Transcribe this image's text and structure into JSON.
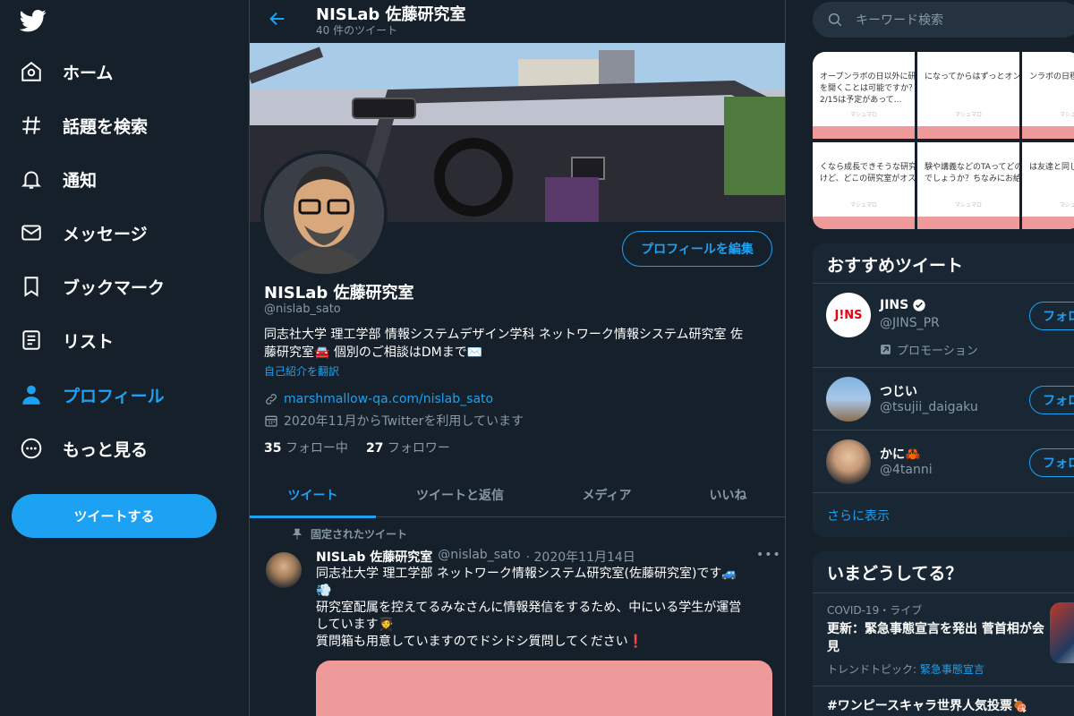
{
  "colors": {
    "background": "#15202b",
    "accent": "#1da1f2",
    "border": "#38444d",
    "muted": "#8899a6",
    "panel": "#192734"
  },
  "nav": {
    "logo_icon": "twitter-bird-icon",
    "items": [
      {
        "label": "ホーム",
        "icon": "home-icon"
      },
      {
        "label": "話題を検索",
        "icon": "hashtag-icon"
      },
      {
        "label": "通知",
        "icon": "bell-icon"
      },
      {
        "label": "メッセージ",
        "icon": "envelope-icon"
      },
      {
        "label": "ブックマーク",
        "icon": "bookmark-icon"
      },
      {
        "label": "リスト",
        "icon": "list-icon"
      },
      {
        "label": "プロフィール",
        "icon": "person-icon",
        "active": true
      },
      {
        "label": "もっと見る",
        "icon": "more-circle-icon"
      }
    ],
    "tweet_button": "ツイートする"
  },
  "header": {
    "title": "NISLab 佐藤研究室",
    "subtitle": "40 件のツイート"
  },
  "profile": {
    "edit_button": "プロフィールを編集",
    "name": "NISLab 佐藤研究室",
    "handle": "@nislab_sato",
    "bio_line1": "同志社大学 理工学部 情報システムデザイン学科 ネットワーク情報システム研究室 佐",
    "bio_line2": "藤研究室🚘 個別のご相談はDMまで✉️",
    "translate": "自己紹介を翻訳",
    "link": "marshmallow-qa.com/nislab_sato",
    "joined": "2020年11月からTwitterを利用しています",
    "following_count": "35",
    "following_label": "フォロー中",
    "followers_count": "27",
    "followers_label": "フォロワー"
  },
  "tabs": [
    "ツイート",
    "ツイートと返信",
    "メディア",
    "いいね"
  ],
  "pinned_tweet": {
    "pinned_label": "固定されたツイート",
    "author": "NISLab 佐藤研究室",
    "handle": "@nislab_sato",
    "date": "· 2020年11月14日",
    "more": "•••",
    "line1": "同志社大学 理工学部 ネットワーク情報システム研究室(佐藤研究室)です🚙",
    "line2": "💨",
    "line3": "研究室配属を控えてるみなさんに情報発信をするため、中にいる学生が運営",
    "line4": "しています🧑‍🎓",
    "line5": "質問箱も用意していますのでドシドシ質問してください❗"
  },
  "search": {
    "placeholder": "キーワード検索"
  },
  "media": [
    {
      "text1": "オープンラボの日以外に研究室",
      "text2": "を開くことは可能ですか？",
      "text3": "2/15は予定があって..."
    },
    {
      "text1": "になってからはずっとオンライン",
      "text2": "",
      "text3": ""
    },
    {
      "text1": "ンラボの日程っ",
      "text2": "",
      "text3": ""
    },
    {
      "text1": "くなら成長できそうな研究室に行き",
      "text2": "けど、どこの研究室がオススメです",
      "text3": ""
    },
    {
      "text1": "験や講義などのTAってどのように決",
      "text2": "でしょうか？ちなみにお給料とかっ",
      "text3": ""
    },
    {
      "text1": "は友達と同じこ",
      "text2": "",
      "text3": ""
    }
  ],
  "media_brand": "マシュマロ",
  "recommended": {
    "title": "おすすめツイート",
    "users": [
      {
        "name": "JINS",
        "handle": "@JINS_PR",
        "promo": "プロモーション",
        "follow": "フォロ",
        "avatar_text": "J!NS"
      },
      {
        "name": "つじい",
        "handle": "@tsujii_daigaku",
        "follow": "フォロ"
      },
      {
        "name": "かに🦀",
        "handle": "@4tanni",
        "follow": "フォロ"
      }
    ],
    "show_more": "さらに表示"
  },
  "trends": {
    "title": "いまどうしてる？",
    "items": [
      {
        "meta": "COVID-19・ライブ",
        "title": "更新：緊急事態宣言を発出 菅首相が会見",
        "sub_prefix": "トレンドトピック: ",
        "sub_link": "緊急事態宣言"
      },
      {
        "title": "#ワンピースキャラ世界人気投票🍖"
      }
    ]
  }
}
